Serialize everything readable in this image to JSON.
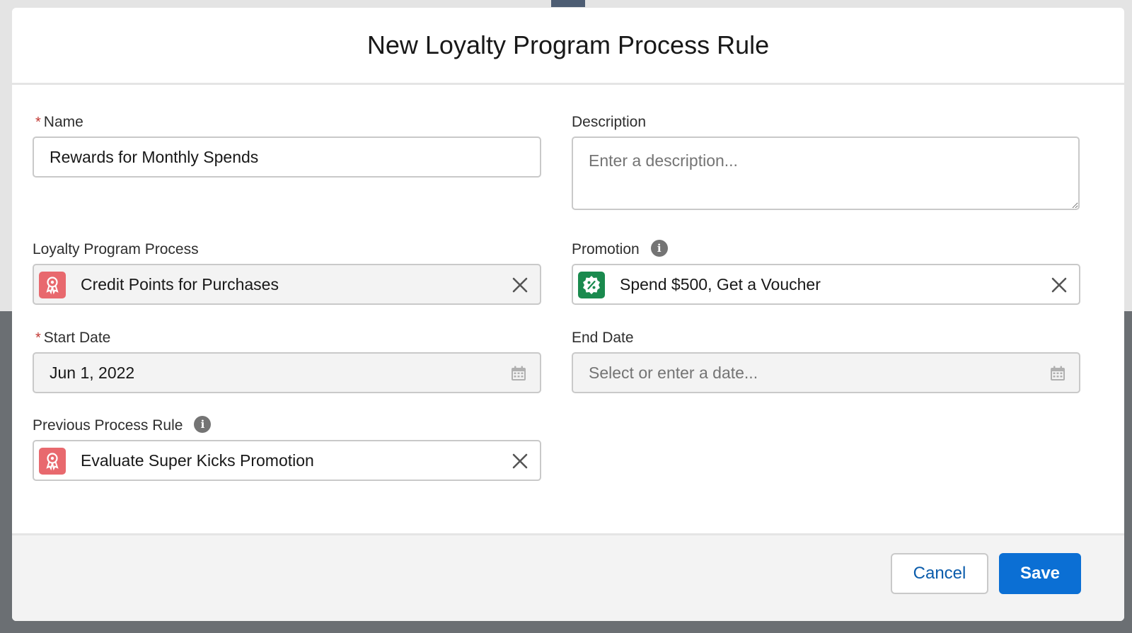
{
  "modal": {
    "title": "New Loyalty Program Process Rule"
  },
  "form": {
    "name": {
      "label": "Name",
      "required_marker": "*",
      "value": "Rewards for Monthly Spends"
    },
    "description": {
      "label": "Description",
      "placeholder": "Enter a description..."
    },
    "loyalty_program_process": {
      "label": "Loyalty Program Process",
      "value": "Credit Points for Purchases",
      "icon": "loyalty-award-icon",
      "icon_color": "#e8696e"
    },
    "promotion": {
      "label": "Promotion",
      "info_icon": "i",
      "value": "Spend $500, Get a Voucher",
      "icon": "promotion-percent-icon",
      "icon_color": "#1a8a4e"
    },
    "start_date": {
      "label": "Start Date",
      "required_marker": "*",
      "value": "Jun 1, 2022",
      "icon": "calendar-icon"
    },
    "end_date": {
      "label": "End Date",
      "placeholder": "Select or enter a date...",
      "icon": "calendar-icon"
    },
    "previous_process_rule": {
      "label": "Previous Process Rule",
      "info_icon": "i",
      "value": "Evaluate Super Kicks Promotion",
      "icon": "loyalty-award-icon",
      "icon_color": "#e8696e"
    }
  },
  "footer": {
    "cancel_label": "Cancel",
    "save_label": "Save"
  },
  "colors": {
    "brand_blue": "#0b6fd4",
    "required_red": "#c23934",
    "border": "#c9c9c9"
  }
}
